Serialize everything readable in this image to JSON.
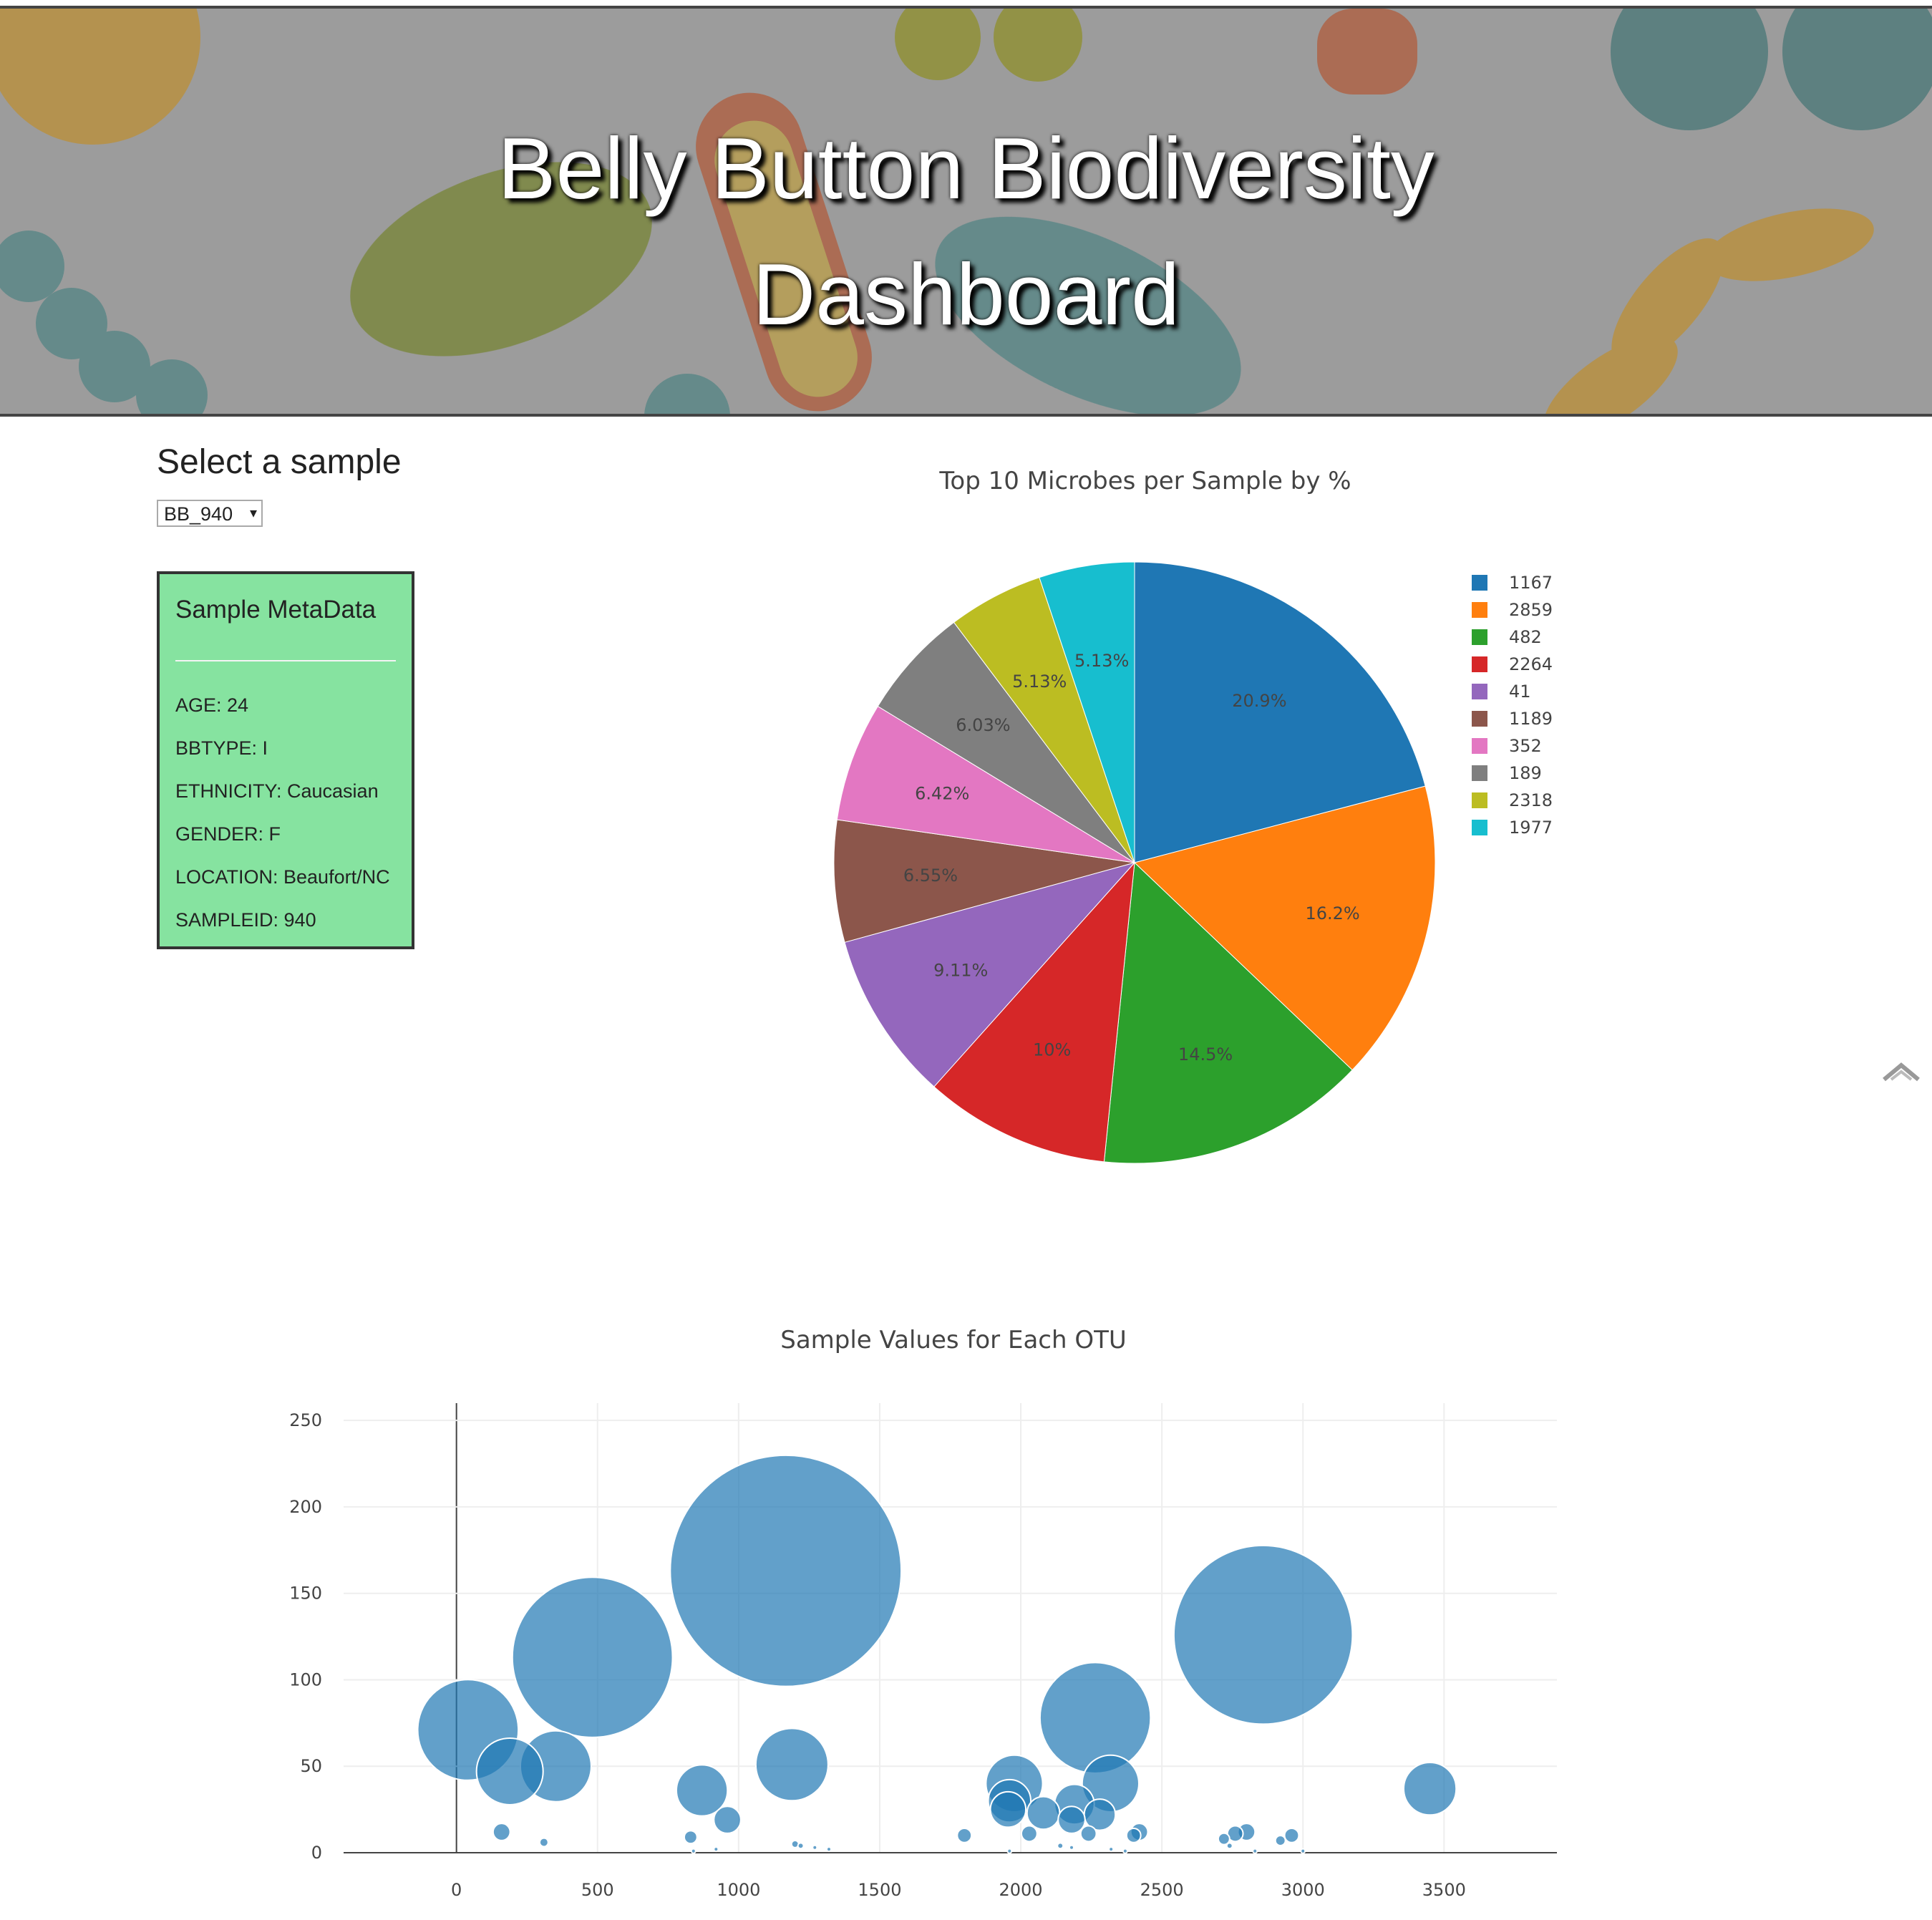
{
  "header": {
    "title_line1": "Belly Button Biodiversity",
    "title_line2": "Dashboard"
  },
  "selector": {
    "label": "Select a sample",
    "selected": "BB_940"
  },
  "metadata": {
    "title": "Sample MetaData",
    "rows": [
      "AGE: 24",
      "BBTYPE: I",
      "ETHNICITY: Caucasian",
      "GENDER: F",
      "LOCATION: Beaufort/NC",
      "SAMPLEID: 940"
    ]
  },
  "colors": {
    "metadata_bg": "#86e3a0",
    "bubble": "#1f77b4"
  },
  "chart_data": [
    {
      "type": "pie",
      "title": "Top 10 Microbes per Sample by %",
      "legend_position": "right",
      "labels": [
        "1167",
        "2859",
        "482",
        "2264",
        "41",
        "1189",
        "352",
        "189",
        "2318",
        "1977"
      ],
      "values": [
        20.9,
        16.2,
        14.5,
        10,
        9.11,
        6.55,
        6.42,
        6.03,
        5.13,
        5.13
      ],
      "text": [
        "20.9%",
        "16.2%",
        "14.5%",
        "10%",
        "9.11%",
        "6.55%",
        "6.42%",
        "6.03%",
        "5.13%",
        "5.13%"
      ],
      "colors": [
        "#1f77b4",
        "#ff7f0e",
        "#2ca02c",
        "#d62728",
        "#9467bd",
        "#8c564b",
        "#e377c2",
        "#7f7f7f",
        "#bcbd22",
        "#17becf"
      ]
    },
    {
      "type": "scatter",
      "title": "Sample Values for Each OTU",
      "xlim": [
        -400,
        3900
      ],
      "ylim": [
        0,
        260
      ],
      "xticks": [
        0,
        500,
        1000,
        1500,
        2000,
        2500,
        3000,
        3500
      ],
      "yticks": [
        0,
        50,
        100,
        150,
        200,
        250
      ],
      "grid": true,
      "points": [
        {
          "x": 1167,
          "y": 163
        },
        {
          "x": 2859,
          "y": 126
        },
        {
          "x": 482,
          "y": 113
        },
        {
          "x": 2264,
          "y": 78
        },
        {
          "x": 41,
          "y": 71
        },
        {
          "x": 1189,
          "y": 51
        },
        {
          "x": 352,
          "y": 50
        },
        {
          "x": 189,
          "y": 47
        },
        {
          "x": 2318,
          "y": 40
        },
        {
          "x": 1977,
          "y": 40
        },
        {
          "x": 3450,
          "y": 37
        },
        {
          "x": 870,
          "y": 36
        },
        {
          "x": 1960,
          "y": 30
        },
        {
          "x": 1955,
          "y": 25
        },
        {
          "x": 2190,
          "y": 28
        },
        {
          "x": 2080,
          "y": 23
        },
        {
          "x": 2280,
          "y": 22
        },
        {
          "x": 960,
          "y": 19
        },
        {
          "x": 2180,
          "y": 19
        },
        {
          "x": 2420,
          "y": 12
        },
        {
          "x": 2800,
          "y": 12
        },
        {
          "x": 2760,
          "y": 11
        },
        {
          "x": 2240,
          "y": 11
        },
        {
          "x": 2030,
          "y": 11
        },
        {
          "x": 160,
          "y": 12
        },
        {
          "x": 2960,
          "y": 10
        },
        {
          "x": 1800,
          "y": 10
        },
        {
          "x": 830,
          "y": 9
        },
        {
          "x": 2720,
          "y": 8
        },
        {
          "x": 2400,
          "y": 10
        },
        {
          "x": 2920,
          "y": 7
        },
        {
          "x": 310,
          "y": 6
        },
        {
          "x": 1200,
          "y": 5
        },
        {
          "x": 2740,
          "y": 4
        },
        {
          "x": 1220,
          "y": 4
        },
        {
          "x": 2140,
          "y": 4
        },
        {
          "x": 1270,
          "y": 3
        },
        {
          "x": 1320,
          "y": 2
        },
        {
          "x": 2180,
          "y": 3
        },
        {
          "x": 2320,
          "y": 2
        },
        {
          "x": 920,
          "y": 2
        },
        {
          "x": 840,
          "y": 1
        },
        {
          "x": 1960,
          "y": 1
        },
        {
          "x": 3000,
          "y": 1
        },
        {
          "x": 2830,
          "y": 1
        },
        {
          "x": 2370,
          "y": 1
        }
      ]
    }
  ]
}
